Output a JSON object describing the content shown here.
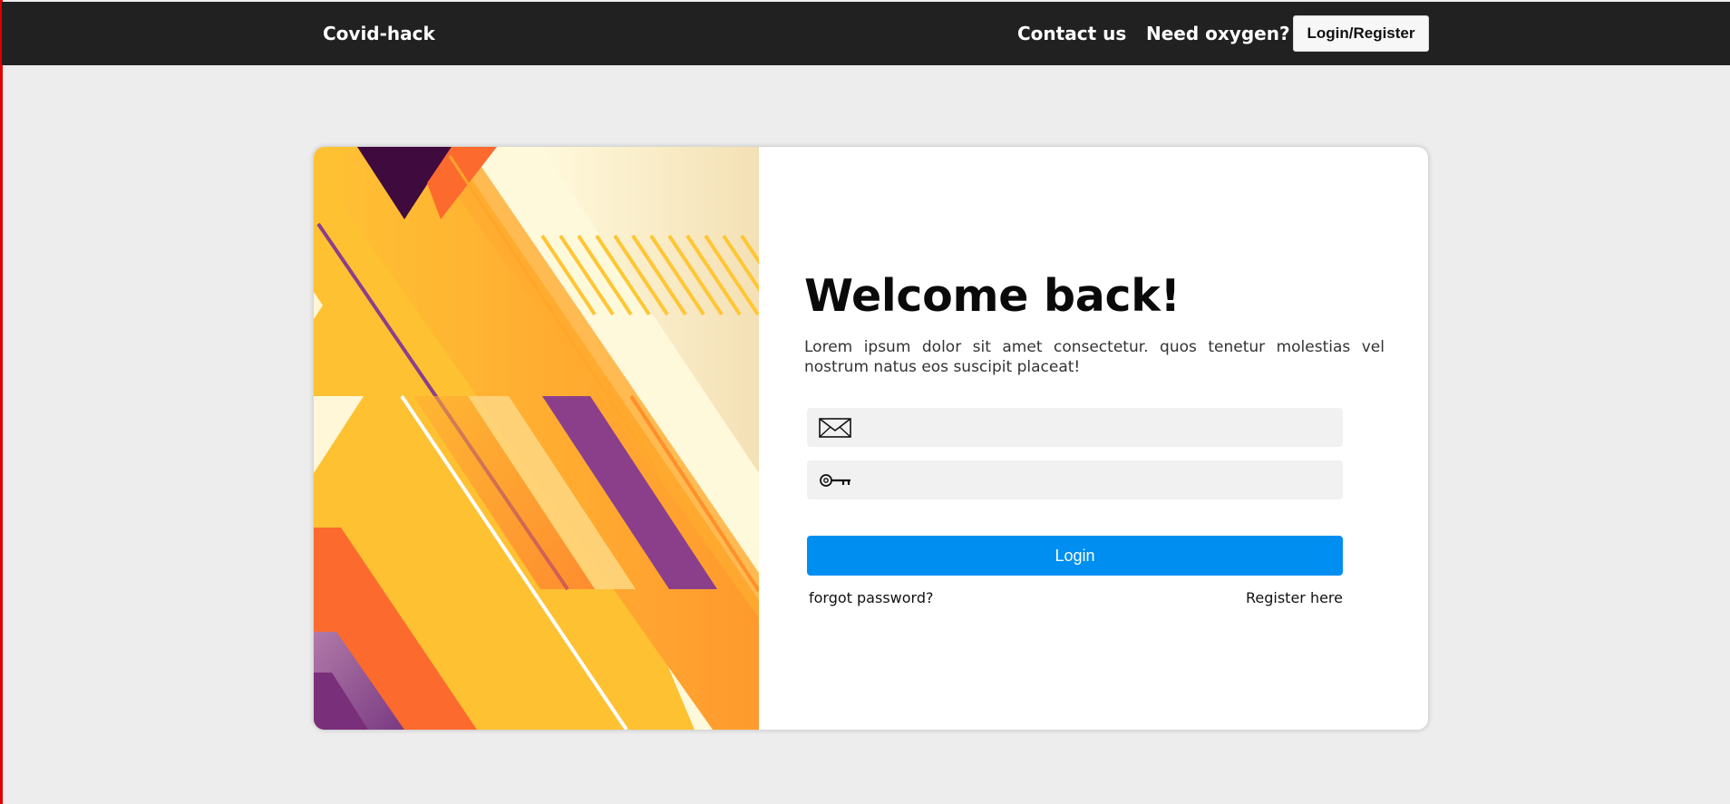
{
  "navbar": {
    "brand": "Covid-hack",
    "links": [
      "Contact us",
      "Need oxygen?"
    ],
    "login_register_label": "Login/Register"
  },
  "login": {
    "title": "Welcome back!",
    "intro": "Lorem ipsum dolor sit amet consectetur. quos tenetur molestias vel nostrum natus eos suscipit placeat!",
    "email": {
      "value": "",
      "icon": "envelope-icon"
    },
    "password": {
      "value": "",
      "icon": "key-icon"
    },
    "submit_label": "Login",
    "forgot_label": "forgot password?",
    "register_label": "Register here"
  },
  "colors": {
    "navbar_bg": "#212121",
    "page_bg": "#ededed",
    "accent": "#008ff1",
    "art_yellow": "#fec132",
    "art_orange": "#fd6a2e",
    "art_purple": "#8b3f8b",
    "art_cream": "#fff9dc"
  }
}
